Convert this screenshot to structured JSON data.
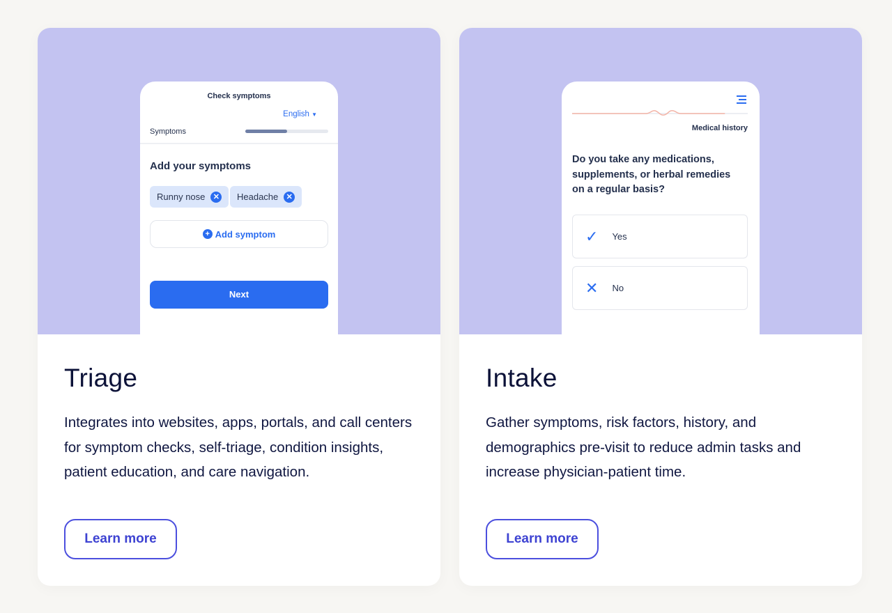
{
  "cards": [
    {
      "title": "Triage",
      "description": "Integrates into websites, apps, portals, and call centers for symptom checks, self-triage, condition insights, patient education, and care navigation.",
      "cta": "Learn more",
      "mockup": {
        "header": "Check symptoms",
        "language": "English",
        "step_label": "Symptoms",
        "progress_percent": 50,
        "heading": "Add your symptoms",
        "chips": [
          "Runny nose",
          "Headache"
        ],
        "add_label": "Add symptom",
        "next_label": "Next"
      }
    },
    {
      "title": "Intake",
      "description": "Gather symptoms, risk factors, history, and demographics pre-visit to reduce admin tasks and increase physician-patient time.",
      "cta": "Learn more",
      "mockup": {
        "section_label": "Medical history",
        "progress_percent": 87,
        "question": "Do you take any medications, supplements, or herbal remedies on a regular basis?",
        "options": [
          {
            "label": "Yes",
            "icon": "check-icon"
          },
          {
            "label": "No",
            "icon": "x-icon"
          }
        ]
      }
    }
  ],
  "colors": {
    "hero": "#c3c3f1",
    "primary": "#2a6cf0",
    "cta": "#4b4fde",
    "progress_line": "#f3b3a6"
  }
}
